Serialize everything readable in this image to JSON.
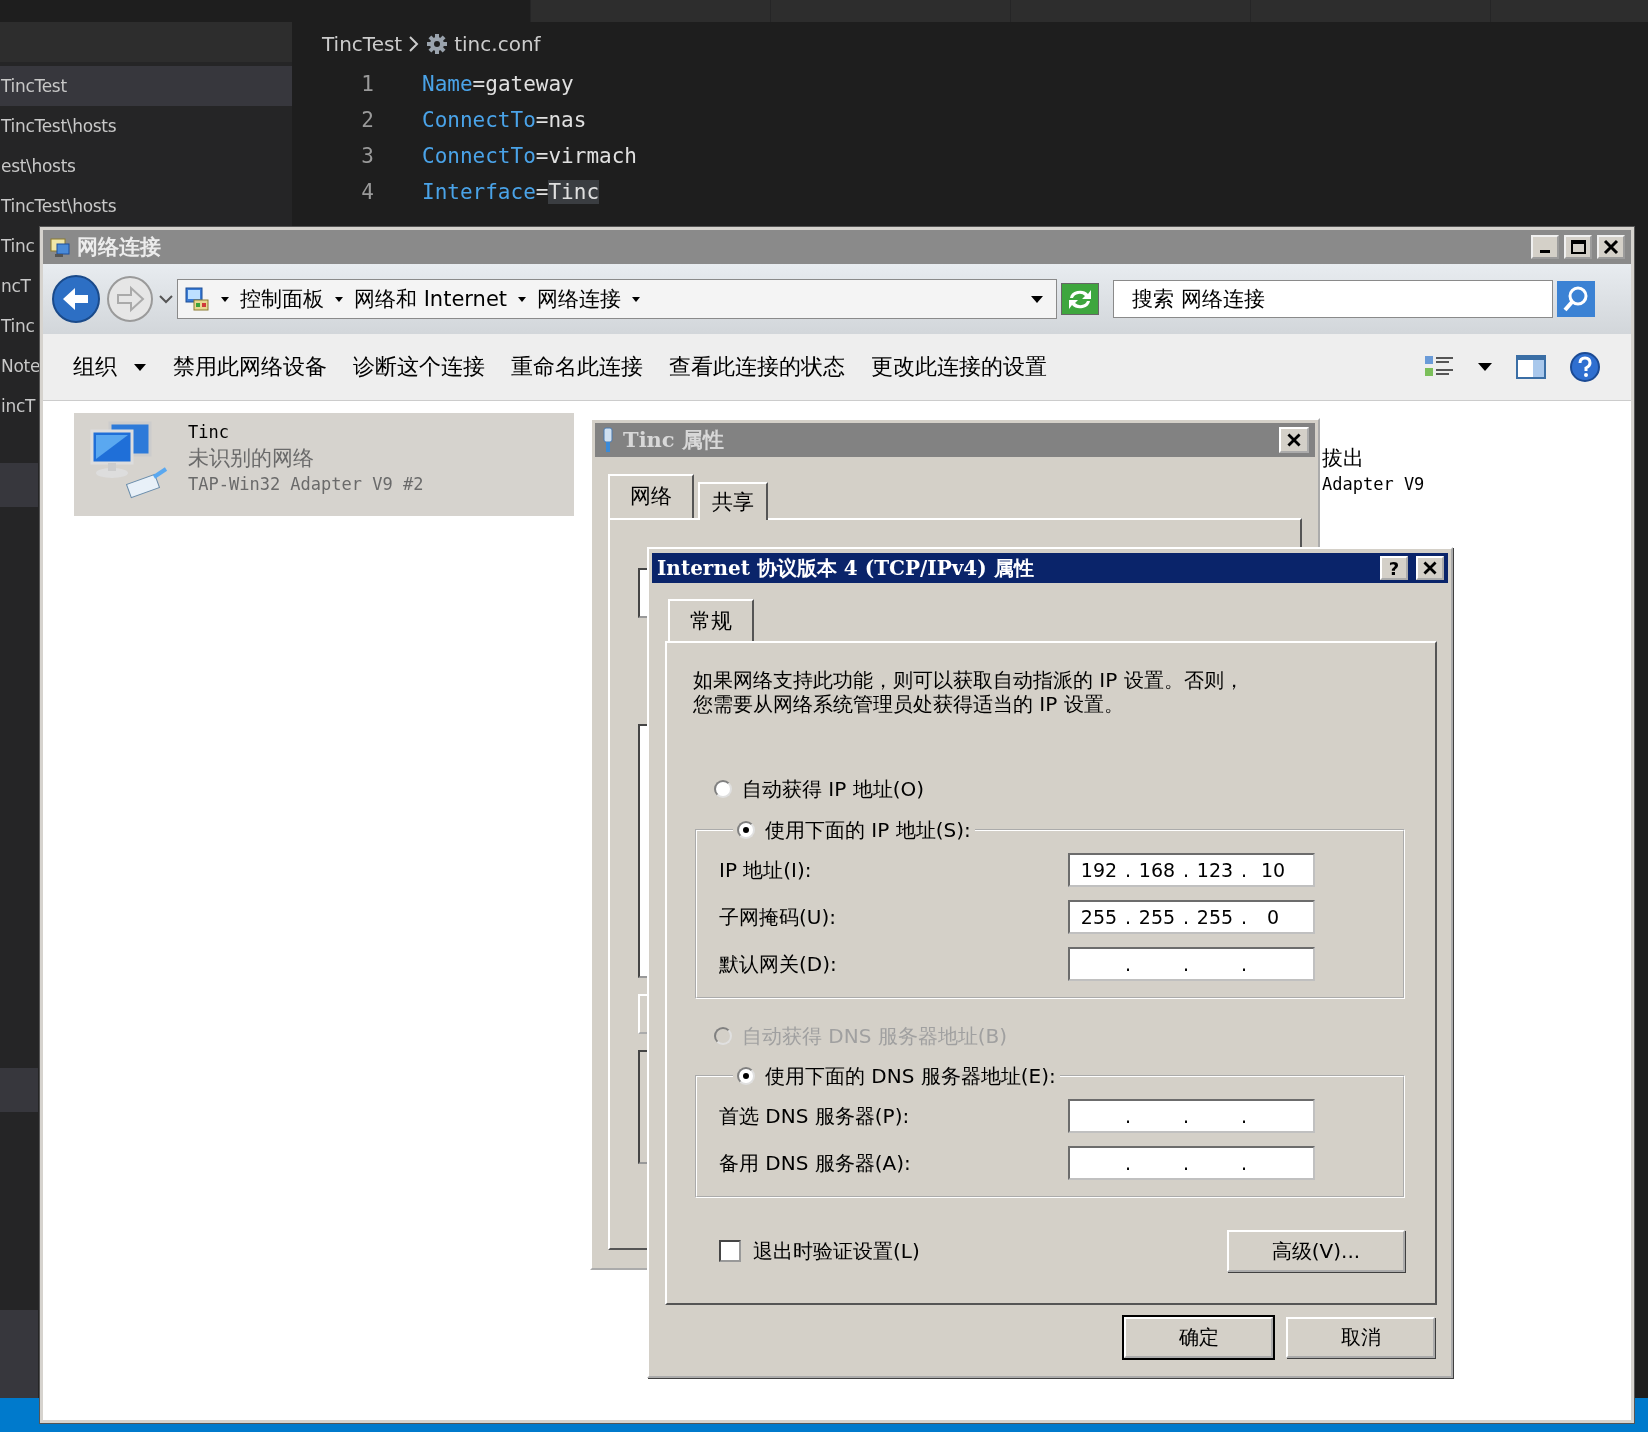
{
  "editor": {
    "breadcrumb": [
      "TincTest",
      "tinc.conf"
    ],
    "lines": [
      {
        "number": "1",
        "key": "Name",
        "sep": "=",
        "value": "gateway",
        "highlight": false
      },
      {
        "number": "2",
        "key": "ConnectTo",
        "sep": "=",
        "value": "nas",
        "highlight": false
      },
      {
        "number": "3",
        "key": "ConnectTo",
        "sep": "=",
        "value": "virmach",
        "highlight": false
      },
      {
        "number": "4",
        "key": "Interface",
        "sep": "=",
        "value": "Tinc",
        "highlight": true
      }
    ]
  },
  "sidebar": {
    "items": [
      {
        "label": "TincTest",
        "selected": true
      },
      {
        "label": "TincTest\\hosts",
        "selected": false
      },
      {
        "label": "est\\hosts",
        "selected": false
      },
      {
        "label": "TincTest\\hosts",
        "selected": false
      },
      {
        "label": "Tinc",
        "selected": false
      },
      {
        "label": "ncT",
        "selected": false
      },
      {
        "label": "Tinc",
        "selected": false
      },
      {
        "label": "Note",
        "selected": false
      },
      {
        "label": "incT",
        "selected": false
      }
    ]
  },
  "explorer": {
    "title": "网络连接",
    "address": [
      "控制面板",
      "网络和 Internet",
      "网络连接"
    ],
    "search": {
      "placeholder": "搜索 网络连接"
    },
    "commands": [
      {
        "label": "组织",
        "dropdown": true
      },
      {
        "label": "禁用此网络设备",
        "dropdown": false
      },
      {
        "label": "诊断这个连接",
        "dropdown": false
      },
      {
        "label": "重命名此连接",
        "dropdown": false
      },
      {
        "label": "查看此连接的状态",
        "dropdown": false
      },
      {
        "label": "更改此连接的设置",
        "dropdown": false
      }
    ],
    "connections": [
      {
        "kind": "full",
        "name": "Tinc",
        "status": "未识别的网络",
        "device": "TAP-Win32 Adapter V9 #2",
        "selected": true
      },
      {
        "kind": "partial",
        "status": "拔出",
        "device": "Adapter V9",
        "selected": false
      }
    ]
  },
  "tinc_dialog": {
    "title": "Tinc 属性",
    "tabs": [
      {
        "label": "网络",
        "selected": true
      },
      {
        "label": "共享",
        "selected": false
      }
    ]
  },
  "ipv4_dialog": {
    "title": "Internet 协议版本 4 (TCP/IPv4) 属性",
    "help": "?",
    "tabs": [
      {
        "label": "常规",
        "selected": true
      }
    ],
    "description": [
      "如果网络支持此功能，则可以获取自动指派的 IP 设置。否则，",
      "您需要从网络系统管理员处获得适当的 IP 设置。"
    ],
    "ip_mode": [
      {
        "label": "自动获得 IP 地址(O)",
        "selected": false,
        "disabled": false
      },
      {
        "label": "使用下面的 IP 地址(S):",
        "selected": true,
        "disabled": false
      }
    ],
    "ip_fields": [
      {
        "label": "IP 地址(I):",
        "octets": [
          "192",
          "168",
          "123",
          "10"
        ],
        "separators": [
          ".",
          ".",
          "."
        ]
      },
      {
        "label": "子网掩码(U):",
        "octets": [
          "255",
          "255",
          "255",
          "0"
        ],
        "separators": [
          ".",
          ".",
          "."
        ]
      },
      {
        "label": "默认网关(D):",
        "separators": [
          ".",
          ".",
          "."
        ]
      }
    ],
    "dns_mode": [
      {
        "label": "自动获得 DNS 服务器地址(B)",
        "selected": false,
        "disabled": true
      },
      {
        "label": "使用下面的 DNS 服务器地址(E):",
        "selected": true,
        "disabled": false
      }
    ],
    "dns_fields": [
      {
        "label": "首选 DNS 服务器(P):",
        "separators": [
          ".",
          ".",
          "."
        ]
      },
      {
        "label": "备用 DNS 服务器(A):",
        "separators": [
          ".",
          ".",
          "."
        ]
      }
    ],
    "validate": {
      "label": "退出时验证设置(L)",
      "checked": false
    },
    "advanced": "高级(V)...",
    "buttons": [
      {
        "label": "确定",
        "default": true
      },
      {
        "label": "取消",
        "default": false
      }
    ]
  }
}
